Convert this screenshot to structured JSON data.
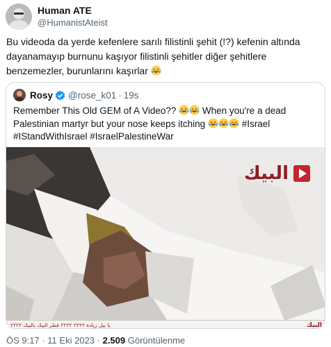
{
  "author": {
    "display_name": "Human ATE",
    "handle": "@HumanistAteist"
  },
  "tweet": {
    "text": "Bu videoda da yerde kefenlere sarılı filistinli şehit (!?) kefenin altında dayanamayıp burnunu kaşıyor  filistinli şehitler diğer şehitlere benzemezler, burunlarını kaşırlar",
    "emoji": "laughing-tears"
  },
  "quoted": {
    "display_name": "Rosy",
    "verified": true,
    "handle": "@rose_k01",
    "separator": "·",
    "time": "19s",
    "text_line1": "Remember This Old GEM of A Video??",
    "text_line2": "When you're a dead Palestinian martyr but your nose keeps itching",
    "hashtags": "#Israel #IStandWithIsrael #IsraelPalestineWar",
    "media": {
      "channel_logo": "البيك",
      "ticker_text": "يا بيل زيادة ٢٢٢٢ ٢٢٢٢ قطر البيك بالبيك ٢٢٢٢",
      "ticker_logo": "البيك"
    }
  },
  "meta": {
    "time": "ÖS 9:17",
    "separator": "·",
    "date": "11 Eki 2023",
    "views_count": "2.509",
    "views_label": "Görüntülenme"
  },
  "colors": {
    "text": "#0f1419",
    "secondary": "#536471",
    "border": "#cfd9de",
    "verified": "#1d9bf0",
    "channel": "#8e1d24"
  }
}
